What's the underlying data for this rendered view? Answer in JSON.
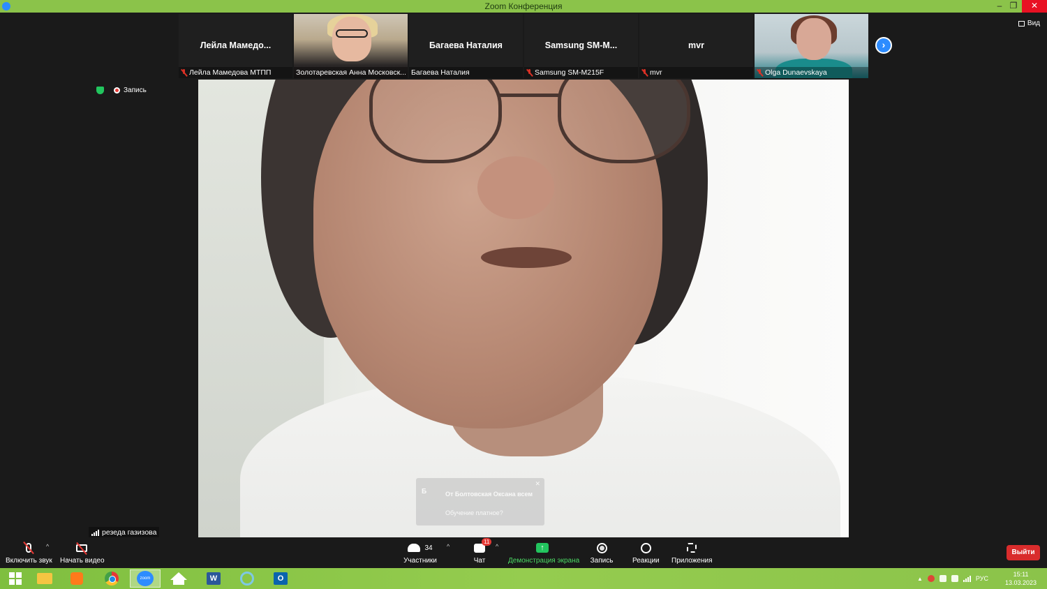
{
  "window": {
    "title": "Zoom Конференция",
    "buttons": {
      "minimize": "–",
      "restore": "❐",
      "close": "✕"
    }
  },
  "top_bar": {
    "view_label": "Вид"
  },
  "participants_strip": [
    {
      "big_name": "Лейла Мамедо...",
      "caption": "Лейла Мамедова МТПП",
      "muted": true,
      "video": false
    },
    {
      "big_name": "",
      "caption": "Золотаревская Анна Московск...",
      "muted": false,
      "video": true
    },
    {
      "big_name": "Багаева Наталия",
      "caption": "Багаева Наталия",
      "muted": false,
      "video": false
    },
    {
      "big_name": "Samsung SM-M...",
      "caption": "Samsung SM-M215F",
      "muted": true,
      "video": false
    },
    {
      "big_name": "mvr",
      "caption": "mvr",
      "muted": true,
      "video": false
    },
    {
      "big_name": "",
      "caption": "Olga Dunaevskaya",
      "muted": true,
      "video": true
    }
  ],
  "status": {
    "recording_label": "Запись"
  },
  "chat_toast": {
    "avatar_letter": "Б",
    "title": "От Болтовская Оксана всем",
    "message": "Обучение платное?",
    "close": "✕"
  },
  "active_speaker": {
    "name": "резеда газизова"
  },
  "toolbar": {
    "unmute_label": "Включить звук",
    "start_video_label": "Начать видео",
    "participants_label": "Участники",
    "participants_count": "34",
    "chat_label": "Чат",
    "chat_badge": "11",
    "share_label": "Демонстрация экрана",
    "record_label": "Запись",
    "reactions_label": "Реакции",
    "apps_label": "Приложения",
    "exit_label": "Выйти",
    "caret": "^"
  },
  "taskbar": {
    "zoom_label": "zoom",
    "word_letter": "W",
    "outlook_letter": "O",
    "language": "РУС",
    "time": "15:11",
    "date": "13.03.2023"
  },
  "colors": {
    "title_bar": "#8bc34a",
    "accent": "#2d8cff",
    "exit": "#d92c2c",
    "share_green": "#22c55e",
    "muted_red": "#d93025"
  }
}
